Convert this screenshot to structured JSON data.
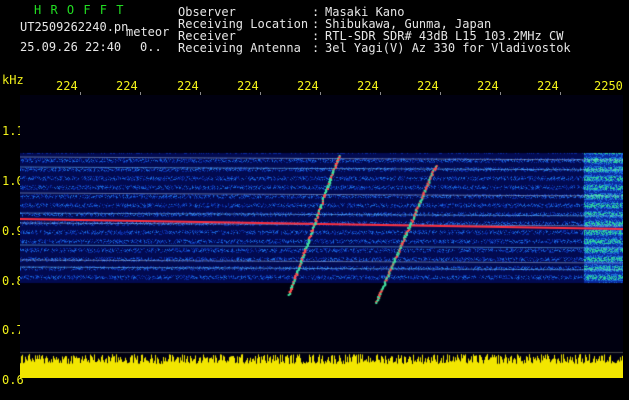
{
  "app_title": "H R O F F T",
  "file_name": "UT2509262240.pn",
  "meteor_label": "meteor",
  "date_time": "25.09.26 22:40",
  "count": "0..",
  "info": {
    "rows": [
      {
        "label": "Observer",
        "value": "Masaki Kano"
      },
      {
        "label": "Receiving Location",
        "value": "Shibukawa, Gunma, Japan"
      },
      {
        "label": "Receiver",
        "value": "RTL-SDR SDR# 43dB L15 103.2MHz CW"
      },
      {
        "label": "Receiving Antenna",
        "value": "3el Yagi(V) Az 330 for Vladivostok"
      }
    ]
  },
  "axis": {
    "y_unit": "kHz",
    "y_ticks": [
      "1.1",
      "1.0",
      "0.9",
      "0.8",
      "0.7",
      "0.6"
    ],
    "x_ticks": [
      "224",
      "224",
      "224",
      "224",
      "224",
      "224",
      "224",
      "224",
      "224",
      "2250"
    ]
  },
  "colors": {
    "text": "#e6e6e6",
    "title": "#22dd22",
    "axis": "#f2f21a",
    "background": "#000000",
    "noise_bar": "#f2e600",
    "carrier": "#ff3040"
  }
}
